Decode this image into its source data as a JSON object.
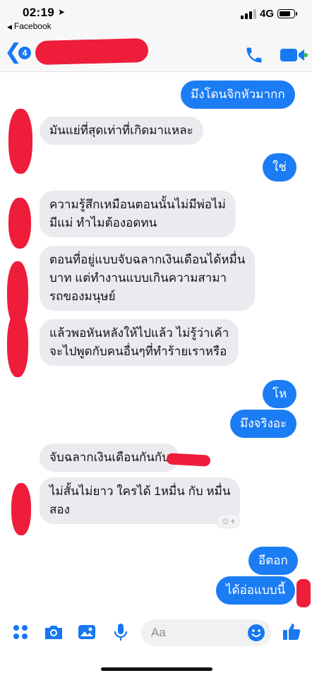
{
  "status_bar": {
    "time": "02:19",
    "back_app": "Facebook",
    "network": "4G",
    "battery_percent": 80
  },
  "header": {
    "unread_count": "4"
  },
  "messages": [
    {
      "side": "out",
      "text": "มึงโดนจิกหัวมากก"
    },
    {
      "side": "in",
      "text": "มันแย่ที่สุดเท่าที่เกิดมาแหละ"
    },
    {
      "side": "out",
      "text": "ใช่"
    },
    {
      "side": "in",
      "text": "ความรู้สึกเหมือนตอนนั้นไม่มีพ่อไม่\nมีแม่ ทำไมต้องอดทน"
    },
    {
      "side": "in",
      "text": "ตอนที่อยู่แบบจับฉลากเงินเดือนได้หมื่น\nบาท แต่ทำงานแบบเกินความสามา\nรถของมนุษย์"
    },
    {
      "side": "in",
      "text": "แล้วพอหันหลังให้ไปแล้ว ไม่รู้ว่าเค้า\nจะไปพูดกับคนอื่นๆที่ทำร้ายเราหรือ"
    },
    {
      "side": "out",
      "text": "โห"
    },
    {
      "side": "out",
      "text": "มึงจริงอะ"
    },
    {
      "side": "in",
      "text": "จับฉลากเงินเดือนกันกับ"
    },
    {
      "side": "in",
      "text": "ไม่สั้นไม่ยาว ใครได้ 1หมื่น กับ หมื่น\nสอง"
    },
    {
      "side": "out",
      "text": "อีตอก"
    },
    {
      "side": "out",
      "text": "ได้อ่อแบบนี้"
    }
  ],
  "reaction_button": "☺+",
  "composer": {
    "placeholder": "Aa"
  },
  "icons": {
    "back": "chevron-left-icon",
    "call": "phone-icon",
    "video": "video-camera-icon",
    "apps": "four-dots-icon",
    "camera": "camera-icon",
    "gallery": "image-icon",
    "mic": "microphone-icon",
    "emoji": "smiley-icon",
    "like": "thumbs-up-icon"
  },
  "colors": {
    "accent": "#1778f2",
    "outgoing_bubble": "#1b7cf3",
    "incoming_bubble": "#eaebef",
    "redaction": "#ee1d3a"
  }
}
